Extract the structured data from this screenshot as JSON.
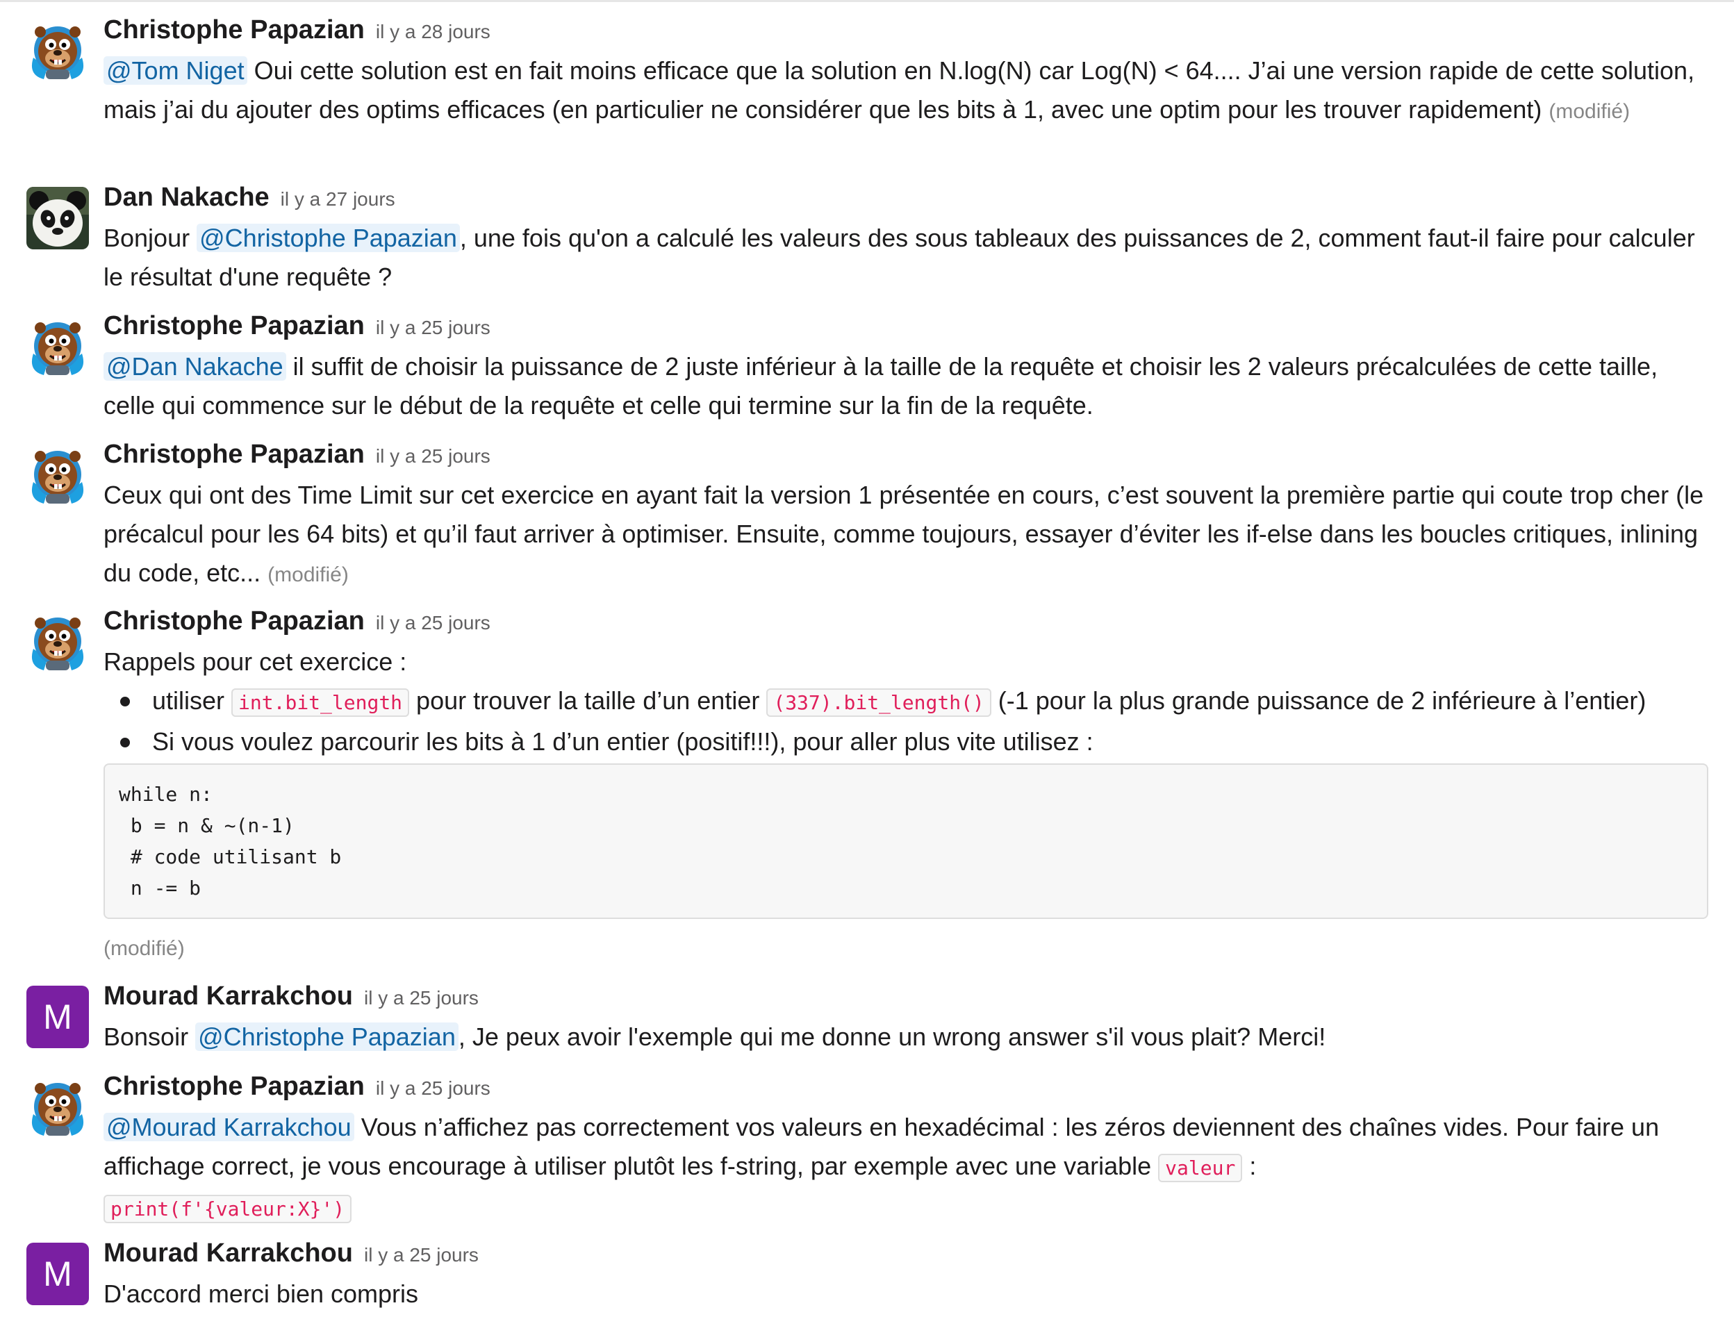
{
  "edited_label": "(modifié)",
  "messages": [
    {
      "author": "Christophe Papazian",
      "time": "il y a 28 jours",
      "mention": "@Tom Niget",
      "text": " Oui cette solution est en fait moins efficace que la solution en N.log(N) car Log(N) < 64.... J’ai une version rapide de cette solution, mais j’ai du ajouter des optims efficaces (en particulier ne considérer que les bits à 1, avec une optim pour les trouver rapidement) "
    },
    {
      "author": "Dan Nakache",
      "time": "il y a 27 jours",
      "text_before": "Bonjour ",
      "mention": "@Christophe Papazian",
      "text_after": ", une fois qu'on a calculé les valeurs des sous tableaux des puissances de 2, comment faut-il faire pour calculer le résultat d'une requête ?"
    },
    {
      "author": "Christophe Papazian",
      "time": "il y a 25 jours",
      "mention": "@Dan Nakache",
      "text": " il suffit de choisir la puissance de 2 juste inférieur à la taille de la requête et choisir les 2 valeurs précalculées de cette taille, celle qui commence sur le début de la requête et celle qui termine sur la fin de la requête."
    },
    {
      "author": "Christophe Papazian",
      "time": "il y a 25 jours",
      "text": "Ceux qui ont des Time Limit sur cet exercice en ayant fait la version 1 présentée en cours, c’est souvent la première partie qui coute trop cher (le précalcul pour les 64 bits) et qu’il faut arriver à optimiser. Ensuite, comme toujours, essayer d’éviter les if-else dans les boucles critiques, inlining du code, etc... "
    },
    {
      "author": "Christophe Papazian",
      "time": "il y a 25 jours",
      "intro": "Rappels pour cet exercice :",
      "bullet1_a": "utiliser ",
      "bullet1_code1": "int.bit_length",
      "bullet1_b": "  pour trouver la taille d’un entier ",
      "bullet1_code2": "(337).bit_length()",
      "bullet1_c": "  (-1 pour la plus grande puissance de 2 inférieure à l’entier)",
      "bullet2": "Si vous voulez parcourir les bits à 1 d’un entier (positif!!!), pour aller plus vite utilisez :",
      "code_block": "while n:\n b = n & ~(n-1)\n # code utilisant b\n n -= b"
    },
    {
      "author": "Mourad Karrakchou",
      "time": "il y a 25 jours",
      "avatar_letter": "M",
      "text_before": "Bonsoir ",
      "mention": "@Christophe Papazian",
      "text_after": ", Je peux avoir l'exemple qui me donne un wrong answer s'il vous plait? Merci!"
    },
    {
      "author": "Christophe Papazian",
      "time": "il y a 25 jours",
      "mention": "@Mourad Karrakchou",
      "text": " Vous n’affichez pas correctement vos valeurs en hexadécimal : les zéros deviennent des chaînes vides. Pour faire un affichage correct, je vous encourage à utiliser plutôt les f-string, par exemple avec une variable ",
      "code_inline": "valeur",
      "text_end": " :",
      "code_line": "print(f'{valeur:X}')"
    },
    {
      "author": "Mourad Karrakchou",
      "time": "il y a 25 jours",
      "avatar_letter": "M",
      "text": "D'accord merci bien compris"
    }
  ],
  "colors": {
    "mention": "#1264a3",
    "mention_bg": "#e8f2fb",
    "code": "#e01e5a",
    "avatar_m": "#7a1fa2"
  },
  "icons": {
    "beaver_avatar": "beaver-mascot-icon",
    "panda_avatar": "panda-avatar"
  }
}
